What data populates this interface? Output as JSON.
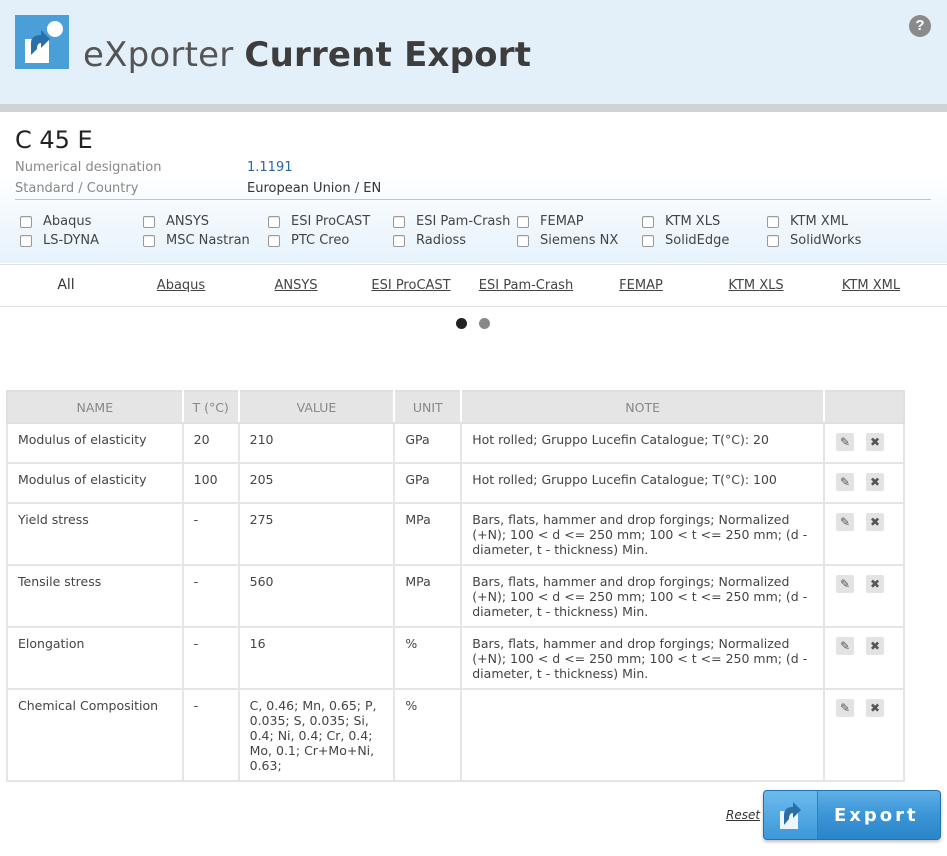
{
  "header": {
    "app_name": "eXporter",
    "page_title": "Current Export",
    "help_label": "?"
  },
  "material": {
    "name": "C 45 E",
    "numerical_designation_label": "Numerical designation",
    "numerical_designation": "1.1191",
    "standard_label": "Standard / Country",
    "standard": "European Union / EN"
  },
  "formats": [
    "Abaqus",
    "ANSYS",
    "ESI ProCAST",
    "ESI Pam-Crash",
    "FEMAP",
    "KTM XLS",
    "KTM XML",
    "LS-DYNA",
    "MSC Nastran",
    "PTC Creo",
    "Radioss",
    "Siemens NX",
    "SolidEdge",
    "SolidWorks"
  ],
  "tabs": [
    "All",
    "Abaqus",
    "ANSYS",
    "ESI ProCAST",
    "ESI Pam-Crash",
    "FEMAP",
    "KTM XLS",
    "KTM XML"
  ],
  "pager": {
    "pages": 2,
    "active": 1
  },
  "table": {
    "columns": [
      "NAME",
      "T (°C)",
      "VALUE",
      "UNIT",
      "NOTE"
    ],
    "rows": [
      {
        "name": "Modulus of elasticity",
        "t": "20",
        "value": "210",
        "unit": "GPa",
        "note": "Hot rolled; Gruppo Lucefin Catalogue; T(°C): 20"
      },
      {
        "name": "Modulus of elasticity",
        "t": "100",
        "value": "205",
        "unit": "GPa",
        "note": "Hot rolled; Gruppo Lucefin Catalogue; T(°C): 100"
      },
      {
        "name": "Yield stress",
        "t": "-",
        "value": "275",
        "unit": "MPa",
        "note": "Bars, flats, hammer and drop forgings; Normalized (+N); 100 < d <= 250 mm; 100 < t <= 250 mm; (d - diameter, t - thickness) Min."
      },
      {
        "name": "Tensile stress",
        "t": "-",
        "value": "560",
        "unit": "MPa",
        "note": "Bars, flats, hammer and drop forgings; Normalized (+N); 100 < d <= 250 mm; 100 < t <= 250 mm; (d - diameter, t - thickness) Min."
      },
      {
        "name": "Elongation",
        "t": "-",
        "value": "16",
        "unit": "%",
        "note": "Bars, flats, hammer and drop forgings; Normalized (+N); 100 < d <= 250 mm; 100 < t <= 250 mm; (d - diameter, t - thickness) Min."
      },
      {
        "name": "Chemical Composition",
        "t": "-",
        "value": "C, 0.46; Mn, 0.65; P, 0.035; S, 0.035; Si, 0.4; Ni, 0.4; Cr, 0.4; Mo, 0.1; Cr+Mo+Ni, 0.63;",
        "unit": "%",
        "note": ""
      }
    ],
    "edit_icon": "pencil-icon",
    "delete_icon": "x-icon"
  },
  "footer": {
    "reset_label": "Reset",
    "export_label": "Export"
  },
  "colors": {
    "header_bg": "#e3f0f9",
    "accent": "#3b95d6",
    "link": "#2a64a6"
  }
}
